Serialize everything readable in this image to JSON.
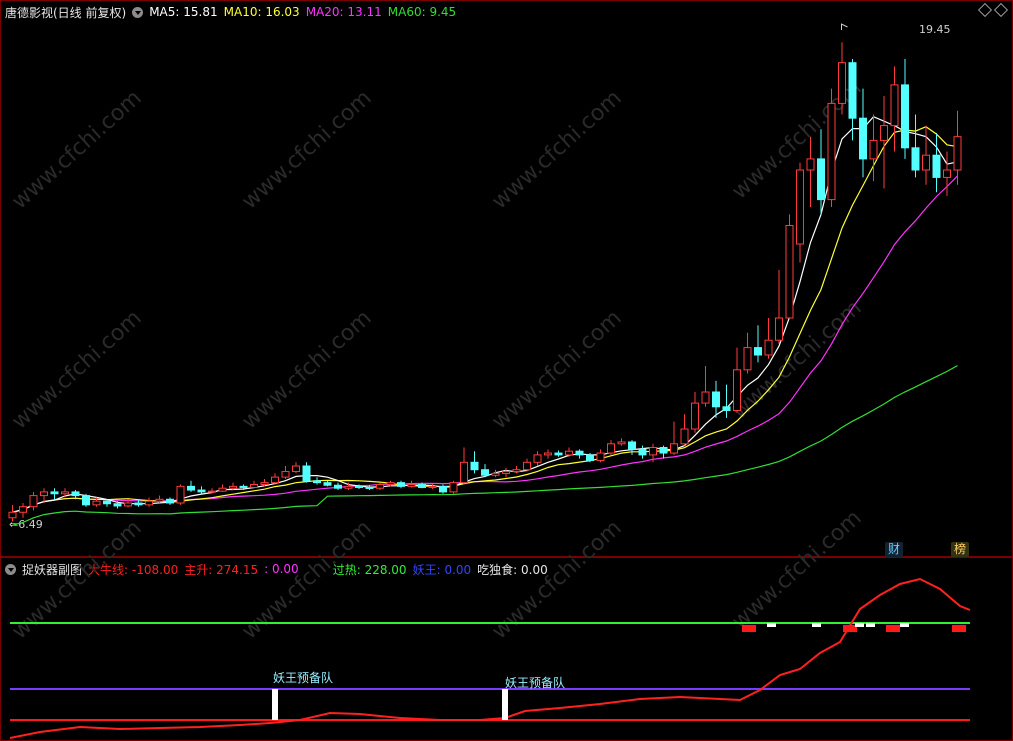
{
  "main": {
    "title": "唐德影视(日线 前复权)",
    "ma": [
      {
        "label": "MA5:",
        "value": "15.81"
      },
      {
        "label": "MA10:",
        "value": "16.03"
      },
      {
        "label": "MA20:",
        "value": "13.11"
      },
      {
        "label": "MA60:",
        "value": "9.45"
      }
    ],
    "high_label": "19.45",
    "low_label": "6.49",
    "badges": {
      "cai": "财",
      "bang": "榜"
    },
    "colors": {
      "up": "#ff3b3b",
      "down": "#54ffff",
      "ma5": "#ffffff",
      "ma10": "#ffff33",
      "ma20": "#ff33ff",
      "ma60": "#33dd33"
    }
  },
  "sub": {
    "title": "捉妖器副图",
    "items": [
      {
        "label": "大牛线:",
        "value": "-108.00"
      },
      {
        "label": "主升:",
        "value": "274.15"
      },
      {
        "label": ":",
        "value": "0.00"
      },
      {
        "label": "过热:",
        "value": "228.00"
      },
      {
        "label": "妖王:",
        "value": "0.00"
      },
      {
        "label": "吃独食:",
        "value": "0.00"
      }
    ],
    "annotation": "妖王预备队"
  },
  "watermark": "www.cfchi.com",
  "chart_data": {
    "type": "candlestick",
    "y_range": [
      6.49,
      19.45
    ],
    "candles": [
      [
        6.6,
        6.75,
        6.95,
        6.5
      ],
      [
        6.75,
        6.9,
        7.0,
        6.6
      ],
      [
        6.9,
        7.2,
        7.3,
        6.8
      ],
      [
        7.2,
        7.3,
        7.4,
        7.0
      ],
      [
        7.3,
        7.25,
        7.4,
        7.1
      ],
      [
        7.25,
        7.3,
        7.4,
        7.15
      ],
      [
        7.3,
        7.2,
        7.35,
        7.1
      ],
      [
        7.2,
        6.95,
        7.25,
        6.9
      ],
      [
        6.95,
        7.05,
        7.15,
        6.9
      ],
      [
        7.05,
        6.98,
        7.1,
        6.9
      ],
      [
        6.98,
        6.92,
        7.05,
        6.85
      ],
      [
        6.92,
        7.0,
        7.1,
        6.88
      ],
      [
        7.0,
        6.95,
        7.1,
        6.9
      ],
      [
        6.95,
        7.05,
        7.15,
        6.9
      ],
      [
        7.05,
        7.1,
        7.2,
        7.0
      ],
      [
        7.1,
        7.0,
        7.15,
        6.95
      ],
      [
        7.0,
        7.45,
        7.5,
        6.95
      ],
      [
        7.45,
        7.35,
        7.6,
        7.3
      ],
      [
        7.35,
        7.3,
        7.45,
        7.25
      ],
      [
        7.3,
        7.32,
        7.4,
        7.25
      ],
      [
        7.32,
        7.4,
        7.5,
        7.3
      ],
      [
        7.4,
        7.45,
        7.55,
        7.35
      ],
      [
        7.45,
        7.42,
        7.5,
        7.35
      ],
      [
        7.42,
        7.5,
        7.6,
        7.4
      ],
      [
        7.5,
        7.55,
        7.65,
        7.45
      ],
      [
        7.55,
        7.7,
        7.8,
        7.5
      ],
      [
        7.7,
        7.85,
        8.0,
        7.65
      ],
      [
        7.85,
        8.0,
        8.1,
        7.8
      ],
      [
        8.0,
        7.6,
        8.1,
        7.55
      ],
      [
        7.6,
        7.55,
        7.7,
        7.5
      ],
      [
        7.55,
        7.48,
        7.6,
        7.45
      ],
      [
        7.48,
        7.4,
        7.55,
        7.35
      ],
      [
        7.4,
        7.45,
        7.55,
        7.35
      ],
      [
        7.45,
        7.42,
        7.5,
        7.38
      ],
      [
        7.42,
        7.4,
        7.48,
        7.35
      ],
      [
        7.4,
        7.5,
        7.55,
        7.35
      ],
      [
        7.5,
        7.55,
        7.6,
        7.45
      ],
      [
        7.55,
        7.45,
        7.6,
        7.4
      ],
      [
        7.45,
        7.5,
        7.6,
        7.42
      ],
      [
        7.5,
        7.42,
        7.55,
        7.4
      ],
      [
        7.42,
        7.45,
        7.52,
        7.38
      ],
      [
        7.45,
        7.3,
        7.5,
        7.25
      ],
      [
        7.3,
        7.55,
        7.6,
        7.25
      ],
      [
        7.55,
        8.1,
        8.5,
        7.5
      ],
      [
        8.1,
        7.9,
        8.4,
        7.8
      ],
      [
        7.9,
        7.75,
        8.05,
        7.7
      ],
      [
        7.75,
        7.8,
        7.9,
        7.7
      ],
      [
        7.8,
        7.85,
        7.95,
        7.7
      ],
      [
        7.85,
        7.9,
        8.0,
        7.8
      ],
      [
        7.9,
        8.1,
        8.2,
        7.85
      ],
      [
        8.1,
        8.3,
        8.4,
        8.0
      ],
      [
        8.3,
        8.35,
        8.45,
        8.2
      ],
      [
        8.35,
        8.3,
        8.42,
        8.25
      ],
      [
        8.3,
        8.4,
        8.5,
        8.25
      ],
      [
        8.4,
        8.3,
        8.45,
        8.2
      ],
      [
        8.3,
        8.15,
        8.35,
        8.1
      ],
      [
        8.15,
        8.35,
        8.45,
        8.1
      ],
      [
        8.35,
        8.6,
        8.7,
        8.3
      ],
      [
        8.6,
        8.65,
        8.75,
        8.55
      ],
      [
        8.65,
        8.45,
        8.7,
        8.3
      ],
      [
        8.45,
        8.3,
        8.55,
        8.2
      ],
      [
        8.3,
        8.5,
        8.6,
        8.1
      ],
      [
        8.5,
        8.35,
        8.55,
        8.2
      ],
      [
        8.35,
        8.6,
        9.2,
        8.3
      ],
      [
        8.6,
        9.0,
        9.4,
        8.55
      ],
      [
        9.0,
        9.7,
        10.0,
        8.9
      ],
      [
        9.7,
        10.0,
        10.7,
        9.6
      ],
      [
        10.0,
        9.6,
        10.3,
        9.3
      ],
      [
        9.6,
        9.5,
        10.2,
        9.3
      ],
      [
        9.5,
        10.6,
        11.2,
        9.45
      ],
      [
        10.6,
        11.2,
        11.6,
        10.5
      ],
      [
        11.2,
        11.0,
        11.8,
        10.8
      ],
      [
        11.0,
        11.4,
        12.0,
        10.9
      ],
      [
        11.4,
        12.0,
        13.3,
        11.3
      ],
      [
        12.0,
        14.5,
        14.8,
        12.0
      ],
      [
        14.0,
        16.0,
        16.2,
        13.5
      ],
      [
        16.0,
        16.3,
        16.9,
        15.0
      ],
      [
        16.3,
        15.2,
        17.1,
        14.8
      ],
      [
        15.2,
        17.8,
        18.2,
        15.0
      ],
      [
        17.8,
        18.9,
        19.45,
        17.5
      ],
      [
        18.9,
        17.4,
        19.0,
        16.8
      ],
      [
        17.4,
        16.3,
        18.2,
        15.8
      ],
      [
        16.3,
        16.8,
        17.5,
        15.7
      ],
      [
        16.8,
        17.2,
        18.0,
        15.5
      ],
      [
        17.2,
        18.3,
        18.8,
        16.5
      ],
      [
        18.3,
        16.6,
        19.0,
        16.3
      ],
      [
        16.6,
        16.0,
        17.5,
        15.8
      ],
      [
        16.0,
        16.4,
        17.2,
        15.6
      ],
      [
        16.4,
        15.8,
        17.0,
        15.4
      ],
      [
        15.8,
        16.0,
        16.5,
        15.3
      ],
      [
        16.0,
        16.9,
        17.6,
        15.6
      ]
    ]
  }
}
